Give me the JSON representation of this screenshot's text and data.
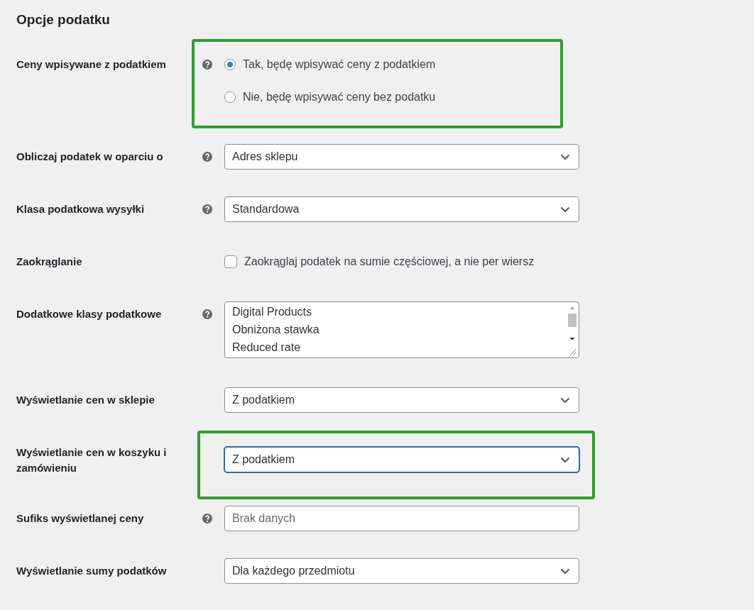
{
  "heading": "Opcje podatku",
  "rows": [
    {
      "kind": "radio",
      "label": "Ceny wpisywane z podatkiem",
      "help": true,
      "highlighted": true,
      "options": [
        {
          "label": "Tak, będę wpisywać ceny z podatkiem",
          "selected": true
        },
        {
          "label": "Nie, będę wpisywać ceny bez podatku",
          "selected": false
        }
      ]
    },
    {
      "kind": "select",
      "label": "Obliczaj podatek w oparciu o",
      "help": true,
      "highlighted": false,
      "value": "Adres sklepu",
      "focused": false
    },
    {
      "kind": "select",
      "label": "Klasa podatkowa wysyłki",
      "help": true,
      "highlighted": false,
      "value": "Standardowa",
      "focused": false
    },
    {
      "kind": "checkbox",
      "label": "Zaokrąglanie",
      "help": false,
      "highlighted": false,
      "text": "Zaokrąglaj podatek na sumie częściowej, a nie per wiersz",
      "checked": false
    },
    {
      "kind": "multiselect",
      "label": "Dodatkowe klasy podatkowe",
      "help": true,
      "highlighted": false,
      "items": [
        "Digital Products",
        "Obniżona stawka",
        "Reduced rate"
      ]
    },
    {
      "kind": "select",
      "label": "Wyświetlanie cen w sklepie",
      "help": false,
      "highlighted": false,
      "value": "Z podatkiem",
      "focused": false
    },
    {
      "kind": "select",
      "label": "Wyświetlanie cen w koszyku i zamówieniu",
      "help": false,
      "highlighted": true,
      "value": "Z podatkiem",
      "focused": true
    },
    {
      "kind": "text",
      "label": "Sufiks wyświetlanej ceny",
      "help": true,
      "highlighted": false,
      "placeholder": "Brak danych"
    },
    {
      "kind": "select",
      "label": "Wyświetlanie sumy podatków",
      "help": false,
      "highlighted": false,
      "value": "Dla każdego przedmiotu",
      "focused": false
    }
  ]
}
